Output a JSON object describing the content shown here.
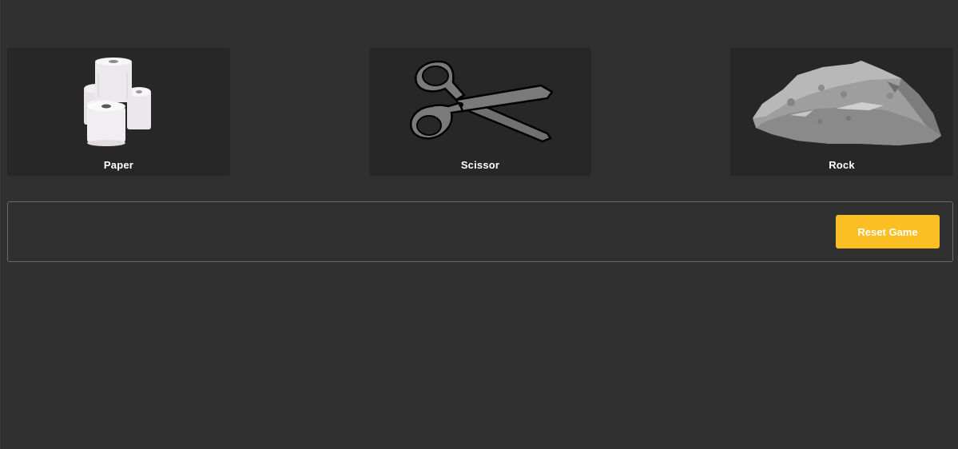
{
  "choices": [
    {
      "id": "paper",
      "label": "Paper",
      "icon": "toilet-paper-rolls-icon"
    },
    {
      "id": "scissor",
      "label": "Scissor",
      "icon": "scissors-icon"
    },
    {
      "id": "rock",
      "label": "Rock",
      "icon": "rock-icon"
    }
  ],
  "controls": {
    "reset_label": "Reset Game"
  },
  "result": {
    "text": ""
  },
  "colors": {
    "background": "#303030",
    "card": "#272727",
    "accent": "#fbbf24",
    "text": "#ffffff"
  }
}
